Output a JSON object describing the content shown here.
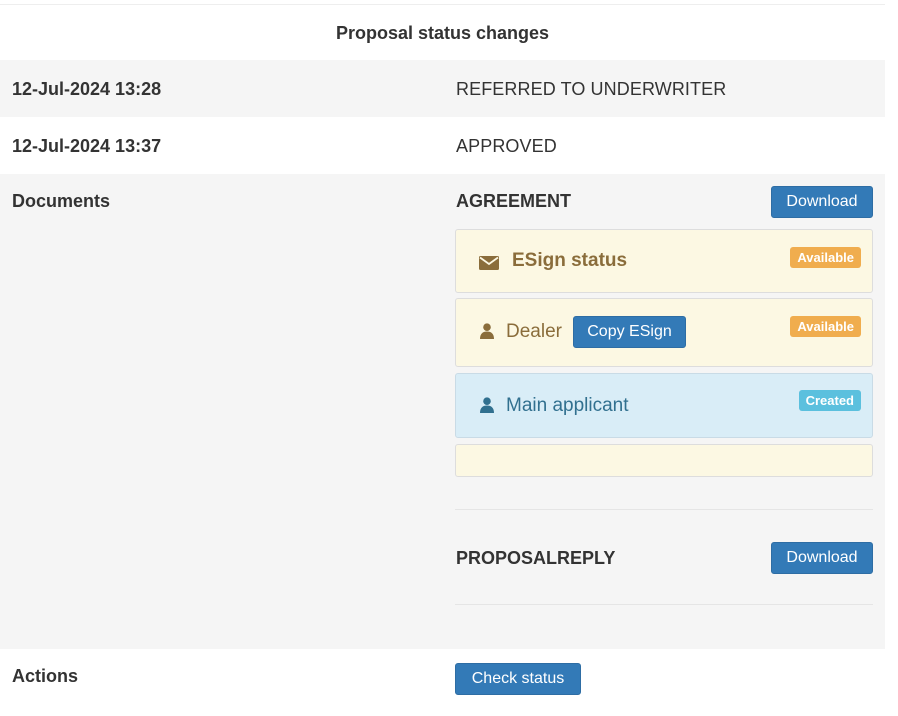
{
  "header": {
    "title": "Proposal status changes"
  },
  "status_changes": [
    {
      "timestamp": "12-Jul-2024 13:28",
      "status": "REFERRED TO UNDERWRITER"
    },
    {
      "timestamp": "12-Jul-2024 13:37",
      "status": "APPROVED"
    }
  ],
  "documents": {
    "label": "Documents",
    "items": [
      {
        "name": "AGREEMENT",
        "download_label": "Download",
        "esign": {
          "title": "ESign status",
          "badge": "Available",
          "signers": [
            {
              "role": "Dealer",
              "copy_label": "Copy ESign",
              "badge": "Available"
            },
            {
              "role": "Main applicant",
              "badge": "Created"
            }
          ]
        }
      },
      {
        "name": "PROPOSALREPLY",
        "download_label": "Download"
      }
    ]
  },
  "actions": {
    "label": "Actions",
    "check_status_label": "Check status"
  },
  "colors": {
    "primary": "#337ab7",
    "warning_bg": "#fcf8e3",
    "info_bg": "#d9edf7",
    "badge_warning": "#f0ad4e",
    "badge_info": "#5bc0de"
  },
  "icons": [
    "envelope-icon",
    "user-icon"
  ]
}
